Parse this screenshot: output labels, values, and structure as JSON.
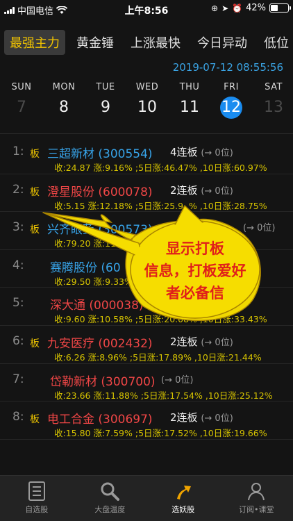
{
  "status_bar": {
    "carrier": "中国电信",
    "time": "上午8:56",
    "battery": "42%",
    "battery_level": 0.42
  },
  "tabs": [
    {
      "label": "最强主力",
      "active": true
    },
    {
      "label": "黄金锤",
      "active": false
    },
    {
      "label": "上涨最快",
      "active": false
    },
    {
      "label": "今日异动",
      "active": false
    },
    {
      "label": "低位",
      "active": false
    }
  ],
  "timestamp": "2019-07-12 08:55:56",
  "week": [
    {
      "name": "SUN",
      "date": "7",
      "state": "muted"
    },
    {
      "name": "MON",
      "date": "8",
      "state": "normal"
    },
    {
      "name": "TUE",
      "date": "9",
      "state": "normal"
    },
    {
      "name": "WED",
      "date": "10",
      "state": "normal"
    },
    {
      "name": "THU",
      "date": "11",
      "state": "normal"
    },
    {
      "name": "FRI",
      "date": "12",
      "state": "selected"
    },
    {
      "name": "SAT",
      "date": "13",
      "state": "muted"
    }
  ],
  "stocks": [
    {
      "rank": "1:",
      "ban": "板",
      "name": "三超新材 (300554)",
      "color": "blue",
      "tag": "4连板",
      "pos": "(→ 0位)",
      "stats": "收:24.87 涨:9.16% ;5日涨:46.47% ,10日涨:60.97%"
    },
    {
      "rank": "2:",
      "ban": "板",
      "name": "澄星股份 (600078)",
      "color": "red",
      "tag": "2连板",
      "pos": "(→ 0位)",
      "stats": "收:5.15 涨:12.18% ;5日涨:25.9..% ,10日涨:28.75%"
    },
    {
      "rank": "3:",
      "ban": "板",
      "name": "兴齐眼药 (300573)",
      "color": "blue",
      "tag": "",
      "pos": "(→ 0位)",
      "stats": "收:79.20 涨:11.22%"
    },
    {
      "rank": "4:",
      "ban": "",
      "name": "赛腾股份 (60",
      "color": "blue",
      "tag": "",
      "pos": "",
      "stats": "收:29.50 涨:9.33%"
    },
    {
      "rank": "5:",
      "ban": "",
      "name": "深大通 (000038)",
      "color": "red",
      "tag": "",
      "pos": "(→ 0位)",
      "stats": "收:9.60 涨:10.58% ;5日涨:20.08% ,10日涨:33.43%"
    },
    {
      "rank": "6:",
      "ban": "板",
      "name": "九安医疗 (002432)",
      "color": "red",
      "tag": "2连板",
      "pos": "(→ 0位)",
      "stats": "收:6.26 涨:8.96% ;5日涨:17.89% ,10日涨:21.44%"
    },
    {
      "rank": "7:",
      "ban": "",
      "name": "岱勒新材 (300700)",
      "color": "red",
      "tag": "",
      "pos": "(→ 0位)",
      "stats": "收:23.66 涨:11.88% ;5日涨:17.54% ,10日涨:25.12%"
    },
    {
      "rank": "8:",
      "ban": "板",
      "name": "电工合金 (300697)",
      "color": "red",
      "tag": "2连板",
      "pos": "(→ 0位)",
      "stats": "收:15.80 涨:7.59% ;5日涨:17.52% ,10日涨:19.66%"
    }
  ],
  "callout": {
    "line1": "显示打板",
    "line2": "信息，打板爱好",
    "line3": "者必备信"
  },
  "bottom_nav": [
    {
      "label": "自选股",
      "icon": "list-icon",
      "active": false
    },
    {
      "label": "大盘温度",
      "icon": "search-icon",
      "active": false
    },
    {
      "label": "选妖股",
      "icon": "trend-arrow-icon",
      "active": true
    },
    {
      "label": "订阅•课堂",
      "icon": "person-icon",
      "active": false
    }
  ],
  "colors": {
    "accent_yellow": "#f2c400",
    "blue": "#37a3e8",
    "red": "#ef4646",
    "selected_day": "#1a8cf0"
  }
}
